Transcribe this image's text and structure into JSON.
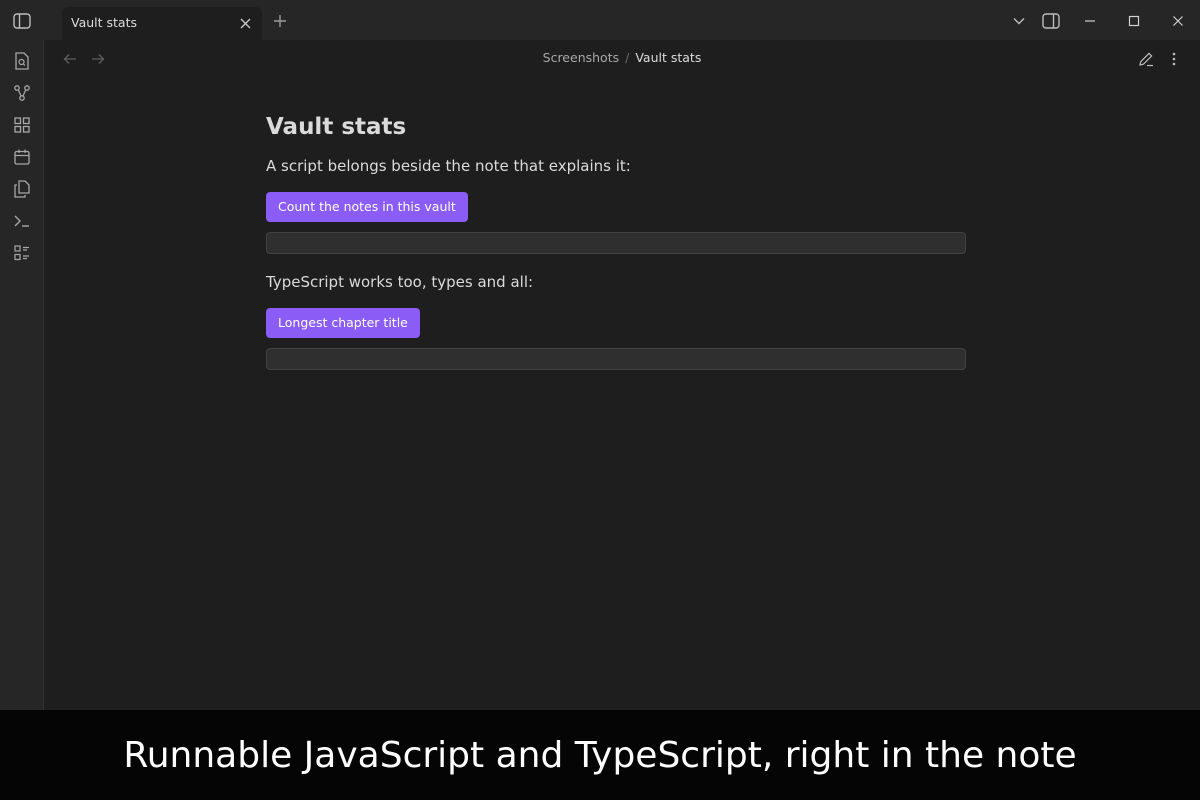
{
  "window": {
    "tab_title": "Vault stats"
  },
  "breadcrumb": {
    "parent": "Screenshots",
    "separator": "/",
    "current": "Vault stats"
  },
  "note": {
    "title": "Vault stats",
    "paragraph_1": "A script belongs beside the note that explains it:",
    "button_1": "Count the notes in this vault",
    "paragraph_2": "TypeScript works too, types and all:",
    "button_2": "Longest chapter title"
  },
  "caption": "Runnable JavaScript and TypeScript, right in the note",
  "colors": {
    "accent": "#8b5cf6",
    "background": "#1e1e1e",
    "chrome": "#262626"
  },
  "icons": {
    "sidebar_toggle": "sidebar-toggle-icon",
    "tab_close": "close-icon",
    "new_tab": "plus-icon",
    "ribbon": [
      "file-search-icon",
      "graph-icon",
      "grid-icon",
      "calendar-icon",
      "copy-files-icon",
      "terminal-icon",
      "checklist-icon"
    ]
  }
}
